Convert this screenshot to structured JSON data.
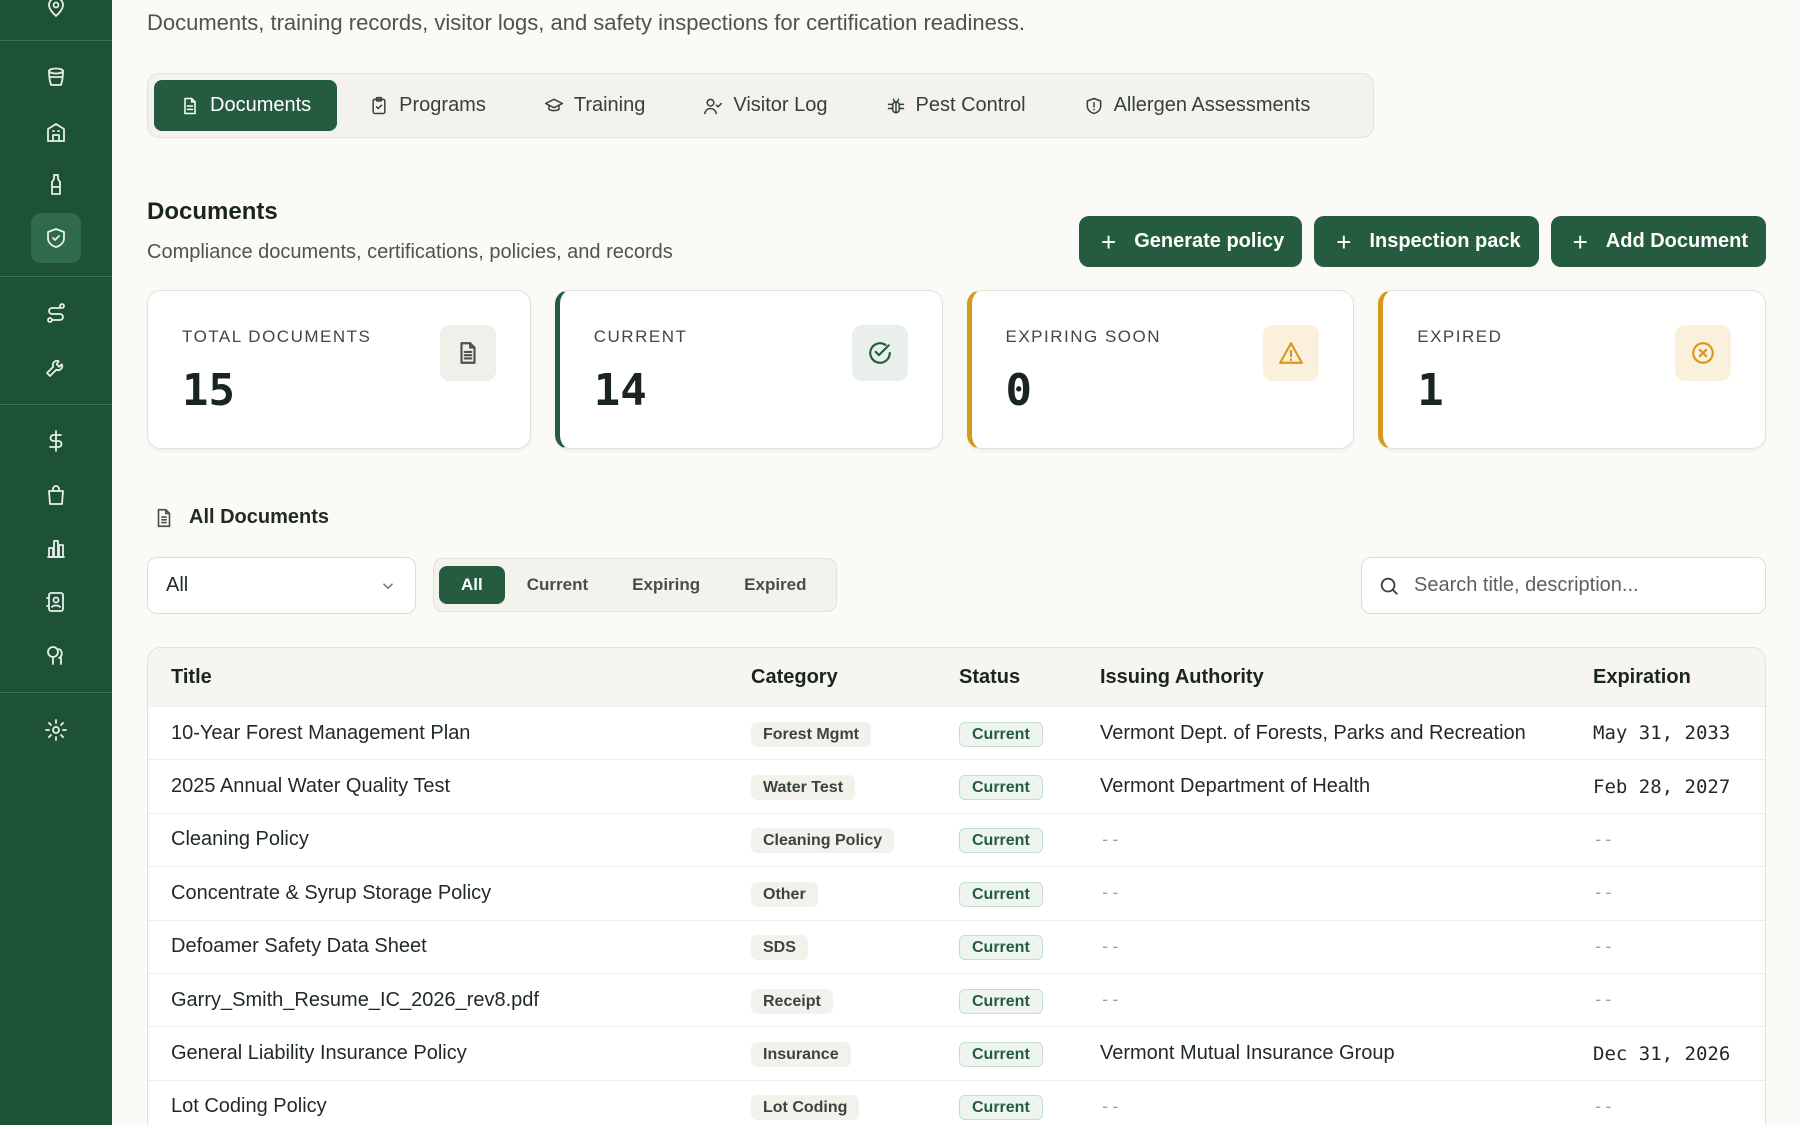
{
  "sidebar": {
    "icons": [
      "map-pin-icon",
      "barrel-icon",
      "building-icon",
      "bottle-icon",
      "shield-icon",
      "route-icon",
      "wrench-icon",
      "dollar-icon",
      "shopping-bag-icon",
      "bar-chart-icon",
      "contact-book-icon",
      "trees-icon",
      "gear-icon"
    ],
    "active": "shield-icon"
  },
  "header": {
    "subtitle": "Documents, training records, visitor logs, and safety inspections for certification readiness."
  },
  "tabs": [
    {
      "label": "Documents",
      "icon": "file-icon"
    },
    {
      "label": "Programs",
      "icon": "clipboard-icon"
    },
    {
      "label": "Training",
      "icon": "graduation-cap-icon"
    },
    {
      "label": "Visitor Log",
      "icon": "user-check-icon"
    },
    {
      "label": "Pest Control",
      "icon": "bug-icon"
    },
    {
      "label": "Allergen Assessments",
      "icon": "shield-alert-icon"
    }
  ],
  "section": {
    "title": "Documents",
    "description": "Compliance documents, certifications, policies, and records"
  },
  "actions": {
    "generate_policy": "Generate policy",
    "inspection_pack": "Inspection pack",
    "add_document": "Add Document"
  },
  "stats": [
    {
      "label": "TOTAL DOCUMENTS",
      "value": "15",
      "icon": "file-text-icon"
    },
    {
      "label": "CURRENT",
      "value": "14",
      "icon": "check-circle-icon"
    },
    {
      "label": "EXPIRING SOON",
      "value": "0",
      "icon": "warning-triangle-icon"
    },
    {
      "label": "EXPIRED",
      "value": "1",
      "icon": "x-circle-icon"
    }
  ],
  "list": {
    "heading": "All Documents",
    "category_select": "All",
    "filters": [
      "All",
      "Current",
      "Expiring",
      "Expired"
    ],
    "search_placeholder": "Search title, description..."
  },
  "table": {
    "columns": [
      "Title",
      "Category",
      "Status",
      "Issuing Authority",
      "Expiration"
    ],
    "rows": [
      {
        "title": "10-Year Forest Management Plan",
        "category": "Forest Mgmt",
        "status": "Current",
        "authority": "Vermont Dept. of Forests, Parks and Recreation",
        "expiration": "May 31, 2033"
      },
      {
        "title": "2025 Annual Water Quality Test",
        "category": "Water Test",
        "status": "Current",
        "authority": "Vermont Department of Health",
        "expiration": "Feb 28, 2027"
      },
      {
        "title": "Cleaning Policy",
        "category": "Cleaning Policy",
        "status": "Current",
        "authority": "--",
        "expiration": "--"
      },
      {
        "title": "Concentrate & Syrup Storage Policy",
        "category": "Other",
        "status": "Current",
        "authority": "--",
        "expiration": "--"
      },
      {
        "title": "Defoamer Safety Data Sheet",
        "category": "SDS",
        "status": "Current",
        "authority": "--",
        "expiration": "--"
      },
      {
        "title": "Garry_Smith_Resume_IC_2026_rev8.pdf",
        "category": "Receipt",
        "status": "Current",
        "authority": "--",
        "expiration": "--"
      },
      {
        "title": "General Liability Insurance Policy",
        "category": "Insurance",
        "status": "Current",
        "authority": "Vermont Mutual Insurance Group",
        "expiration": "Dec 31, 2026"
      },
      {
        "title": "Lot Coding Policy",
        "category": "Lot Coding",
        "status": "Current",
        "authority": "--",
        "expiration": "--"
      }
    ]
  }
}
